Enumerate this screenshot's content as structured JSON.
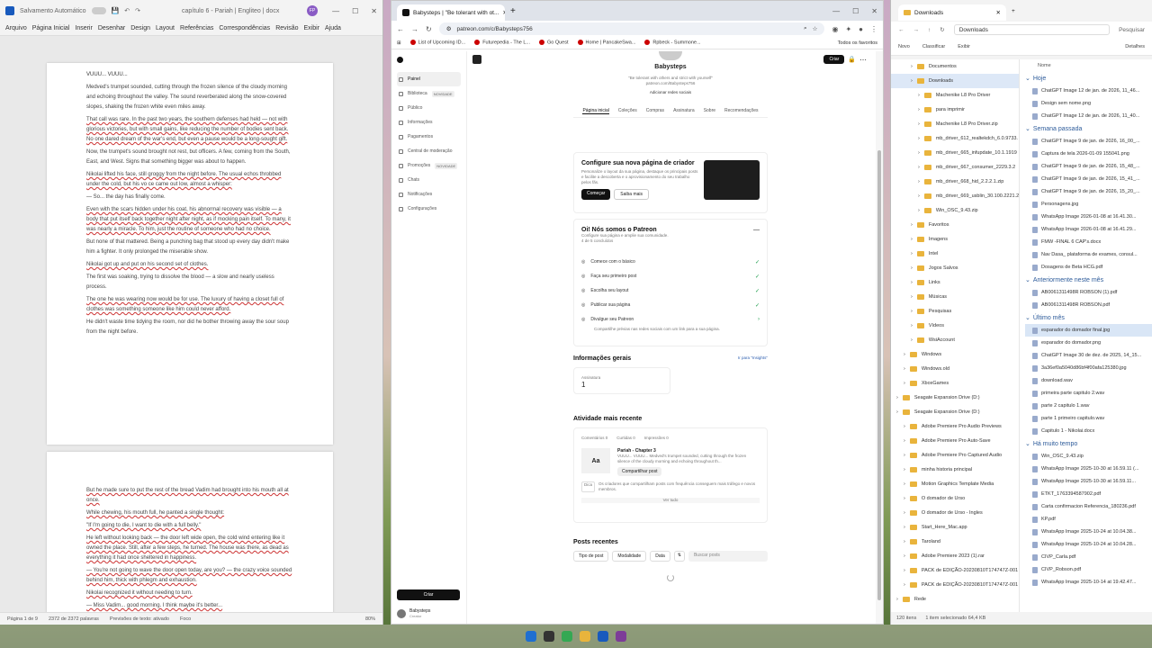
{
  "word": {
    "autosave": "Salvamento Automático",
    "doc_title": "capítulo 6 - Pariah | Engliteo | docx",
    "avatar": "FP",
    "menu": [
      "Arquivo",
      "Página Inicial",
      "Inserir",
      "Desenhar",
      "Design",
      "Layout",
      "Referências",
      "Correspondências",
      "Revisão",
      "Exibir",
      "Ajuda"
    ],
    "page1": {
      "heading": "VUUU... VUUU...",
      "paragraphs": [
        "Medved's trumpet sounded, cutting through the frozen silence of the cloudy morning and echoing throughout the valley. The sound reverberated along the snow-covered slopes, shaking the frozen white even miles away.",
        "That call was rare. In the past two years, the southern defenses had held — not with glorious victories, but with small gains, like reducing the number of bodies sent back. No one dared dream of the war's end, but even a pause would be a long-sought gift.",
        "Now, the trumpet's sound brought not rest, but officers. A few, coming from the South, East, and West. Signs that something bigger was about to happen.",
        "Nikolai lifted his face, still groggy from the night before. The usual echos throbbed under the cold, but his vo ce came out low, almost a whisper:",
        "— So... the day has finally come.",
        "Even with the scars hidden under his coat, his abnormal recovery was visible — a body that put itself back together night after night, as if mocking pain itself. To many, it was nearly a miracle. To him, just the routine of someone who had no choice.",
        "But none of that mattered. Being a punching bag that stood up every day didn't make him a fighter. It only prolonged the miserable show.",
        "Nikolai got up and put on his second set of clothes.",
        "The first was soaking, trying to dissolve the blood — a slow and nearly useless process.",
        "The one he was wearing now would be for use. The luxury of having a closet full of clothes was something someone like him could never afford.",
        "He didn't waste time tidying the room, nor did he bother throwing away the sour soup from the night before."
      ]
    },
    "page2": {
      "paragraphs": [
        "But he made sure to put the rest of the bread Vadim had brought into his mouth all at once.",
        "While chewing, his mouth full, he panted a single thought:",
        "\"If I'm going to die, I want to die with a full belly.\"",
        "He left without looking back — the door left wide open, the cold wind entering like it owned the place. Still, after a few steps, he turned. The house was there, as dead as everything it had once sheltered in happiness.",
        "— You're not going to wave the door open today, are you? — the crazy voice sounded behind him, thick with phlegm and exhaustion.",
        "Nikolai recognized it without needing to turn.",
        "— Miss Vadim... good morning. I think maybe it's better..."
      ]
    },
    "status": {
      "page": "Página 1 de 9",
      "words": "2372 de 2372 palavras",
      "predictions": "Previsões de texto: ativado",
      "focus": "Foco",
      "zoom": "80%"
    }
  },
  "chrome": {
    "tab_title": "Babysteps | \"Be tolerant with ot...",
    "url": "patreon.com/c/Babysteps756",
    "bookmarks": [
      "List of Upcoming ID...",
      "Futurepedia - The L...",
      "Go Quest",
      "Home | PancakeSwa...",
      "Rpbeck - Summone..."
    ],
    "bookmarks_more": "Todos os favoritos",
    "sidebar": {
      "items": [
        {
          "label": "Painel",
          "badge": ""
        },
        {
          "label": "Biblioteca",
          "badge": "NOVIDADE"
        },
        {
          "label": "Público",
          "badge": ""
        },
        {
          "label": "Informações",
          "badge": ""
        },
        {
          "label": "Pagamentos",
          "badge": ""
        },
        {
          "label": "Central de moderação",
          "badge": ""
        },
        {
          "label": "Promoções",
          "badge": "NOVIDADE"
        },
        {
          "label": "Chats",
          "badge": ""
        },
        {
          "label": "Notificações",
          "badge": ""
        },
        {
          "label": "Configurações",
          "badge": ""
        }
      ],
      "create": "Criar",
      "user": "Babysteps",
      "user_role": "Creator"
    },
    "creator": {
      "name": "Babysteps",
      "tagline": "\"Be tolerant with others and strict with yourself\"",
      "link": "patreon.com/Babysteps756",
      "add_link": "Adicionar redes sociais",
      "create_btn": "Criar",
      "tabs": [
        "Página inicial",
        "Coleções",
        "Compras",
        "Assinatura",
        "Sobre",
        "Recomendações"
      ]
    },
    "setup_card": {
      "title": "Configure sua nova página de criador",
      "desc": "Personalize o layout da sua página, destaque os principais posts e facilite a descoberta e o aprovisionamento do seu trabalho pelos fãs.",
      "start": "Começar",
      "learn": "Saiba mais"
    },
    "welcome": {
      "title": "Oi! Nós somos o Patreon",
      "desc": "Configure sua página e amplie sua comunidade.",
      "progress": "4 de 5 concluídos",
      "steps": [
        {
          "label": "Comece com o básico",
          "done": "✓"
        },
        {
          "label": "Faça seu primeiro post",
          "done": "✓"
        },
        {
          "label": "Escolha seu layout",
          "done": "✓"
        },
        {
          "label": "Publicar sua página",
          "done": "✓"
        },
        {
          "label": "Divulgue seu Patreon",
          "done": "›"
        }
      ],
      "share_hint": "Compartilhe prévias nas redes sociais com um link para a sua página."
    },
    "insights": {
      "title": "Informações gerais",
      "link": "Ir para \"Insights\"",
      "metric_label": "Assinatura",
      "metric_value": "1"
    },
    "activity": {
      "title": "Atividade mais recente",
      "filters": [
        "Comentários 0",
        "Curtidas 0",
        "Impressões 0"
      ],
      "post_title": "Pariah - Chapter 3",
      "post_excerpt": "VUUU... VUUU... Medved's trumpet sounded, cutting through the frozen silence of the cloudy morning and echoing throughout th...",
      "share": "Compartilhar post",
      "tip_label": "Dica",
      "tip": "Os criadores que compartilham posts com frequência conseguem mais tráfego e novos membros.",
      "see_all": "Ver tudo"
    },
    "recent": {
      "title": "Posts recentes",
      "filters": [
        "Tipo de post",
        "Modalidade",
        "Data"
      ],
      "search": "Buscar posts"
    }
  },
  "explorer": {
    "tab": "Downloads",
    "path": "Downloads",
    "search": "Pesquisar",
    "toolbar": [
      "Novo",
      "Classificar",
      "Exibir",
      "Detalhes"
    ],
    "tree": [
      {
        "label": "Documentos",
        "sel": false,
        "indent": 2
      },
      {
        "label": "Downloads",
        "sel": true,
        "indent": 2
      },
      {
        "label": "Machenike L8 Pro Driver",
        "sel": false,
        "indent": 3
      },
      {
        "label": "para imprimir",
        "sel": false,
        "indent": 3
      },
      {
        "label": "Machenike L8 Pro Driver.zip",
        "sel": false,
        "indent": 3
      },
      {
        "label": "mb_driver_612_realtekdch_6.0.9733.",
        "sel": false,
        "indent": 3
      },
      {
        "label": "mb_driver_665_infupdate_10.1.1919",
        "sel": false,
        "indent": 3
      },
      {
        "label": "mb_driver_667_consumer_2229.3.2",
        "sel": false,
        "indent": 3
      },
      {
        "label": "mb_driver_668_hid_2.2.2.1.zip",
        "sel": false,
        "indent": 3
      },
      {
        "label": "mb_driver_669_usblin_30.100.2221.2",
        "sel": false,
        "indent": 3
      },
      {
        "label": "Win_OSC_9.43.zip",
        "sel": false,
        "indent": 3
      },
      {
        "label": "Favoritos",
        "sel": false,
        "indent": 2
      },
      {
        "label": "Imagens",
        "sel": false,
        "indent": 2
      },
      {
        "label": "Intel",
        "sel": false,
        "indent": 2
      },
      {
        "label": "Jogos Salvos",
        "sel": false,
        "indent": 2
      },
      {
        "label": "Links",
        "sel": false,
        "indent": 2
      },
      {
        "label": "Músicas",
        "sel": false,
        "indent": 2
      },
      {
        "label": "Pesquisas",
        "sel": false,
        "indent": 2
      },
      {
        "label": "Vídeos",
        "sel": false,
        "indent": 2
      },
      {
        "label": "WsiAccount",
        "sel": false,
        "indent": 2
      },
      {
        "label": "Windows",
        "sel": false,
        "indent": 1
      },
      {
        "label": "Windows.old",
        "sel": false,
        "indent": 1
      },
      {
        "label": "XboxGames",
        "sel": false,
        "indent": 1
      },
      {
        "label": "Seagate Expansion Drive (D:)",
        "sel": false,
        "indent": 0
      },
      {
        "label": "Seagate Expansion Drive (D:)",
        "sel": false,
        "indent": 0
      },
      {
        "label": "Adobe Premiere Pro Audio Previews",
        "sel": false,
        "indent": 1
      },
      {
        "label": "Adobe Premiere Pro Auto-Save",
        "sel": false,
        "indent": 1
      },
      {
        "label": "Adobe Premiere Pro Captured Audio",
        "sel": false,
        "indent": 1
      },
      {
        "label": "minha historia principal",
        "sel": false,
        "indent": 1
      },
      {
        "label": "Motion Graphics Template Media",
        "sel": false,
        "indent": 1
      },
      {
        "label": "O domador de Urso",
        "sel": false,
        "indent": 1
      },
      {
        "label": "O domador de Urso - Ingles",
        "sel": false,
        "indent": 1
      },
      {
        "label": "Start_Here_Mac.app",
        "sel": false,
        "indent": 1
      },
      {
        "label": "Taroland",
        "sel": false,
        "indent": 1
      },
      {
        "label": "Adobe Premiere 2023 (1).rar",
        "sel": false,
        "indent": 1
      },
      {
        "label": "PACK de EDIÇÃO-20230810T174747Z-001",
        "sel": false,
        "indent": 1
      },
      {
        "label": "PACK de EDIÇÃO-20230810T174747Z-001",
        "sel": false,
        "indent": 1
      },
      {
        "label": "Rede",
        "sel": false,
        "indent": 0
      }
    ],
    "column": "Nome",
    "groups": [
      {
        "title": "Hoje",
        "files": [
          "ChatGPT Image 12 de jan. de 2026, 11_46...",
          "Design sem nome.png",
          "ChatGPT Image 12 de jan. de 2026, 11_40..."
        ]
      },
      {
        "title": "Semana passada",
        "files": [
          "ChatGPT Image 9 de jan. de 2026, 16_00_...",
          "Captura de tela 2026-01-09 155041.png",
          "ChatGPT Image 9 de jan. de 2026, 15_48_...",
          "ChatGPT Image 9 de jan. de 2026, 15_41_...",
          "ChatGPT Image 9 de jan. de 2026, 15_20_...",
          "Personagens.jpg",
          "WhatsApp Image 2026-01-08 at 16.41.30...",
          "WhatsApp Image 2026-01-08 at 16.41.29...",
          "FMW -FINAL 6 CAP's.docx",
          "Nav Dasa_ plataforma de exames, consul...",
          "Dosagens de Beta HCG.pdf"
        ]
      },
      {
        "title": "Anteriormente neste mês",
        "files": [
          "AB0061311498R ROBSON (1).pdf",
          "AB0061311498R ROBSON.pdf"
        ]
      },
      {
        "title": "Último mês",
        "files": [
          "esparador do domador final.jpg",
          "esparador do domador.png",
          "ChatGPT Image 30 de dez. de 2025, 14_15...",
          "3a36ef0a5040d86bf4f00afa125380.jpg",
          "download.wav",
          "primeira parte capitulo 2.wav",
          "parte 2 capitulo 1.wav",
          "parte 1 primeiro capitulo.wav",
          "Capitulo 1 - Nikolai.docx"
        ]
      },
      {
        "title": "Há muito tempo",
        "files": [
          "Win_OSC_9.43.zip",
          "WhatsApp Image 2025-10-30 at 16.59.11 (...",
          "WhatsApp Image 2025-10-30 at 16.59.11...",
          "ETKT_1763394587902.pdf",
          "Carta confirmacion Referencia_180236.pdf",
          "KP.pdf",
          "WhatsApp Image 2025-10-24 at 10.04.38...",
          "WhatsApp Image 2025-10-24 at 10.04.28...",
          "CIVP_Carla.pdf",
          "CIVP_Robson.pdf",
          "WhatsApp Image 2025-10-14 at 19.42.47..."
        ]
      }
    ],
    "status_items": "120 itens",
    "status_sel": "1 item selecionado  64,4 KB"
  }
}
